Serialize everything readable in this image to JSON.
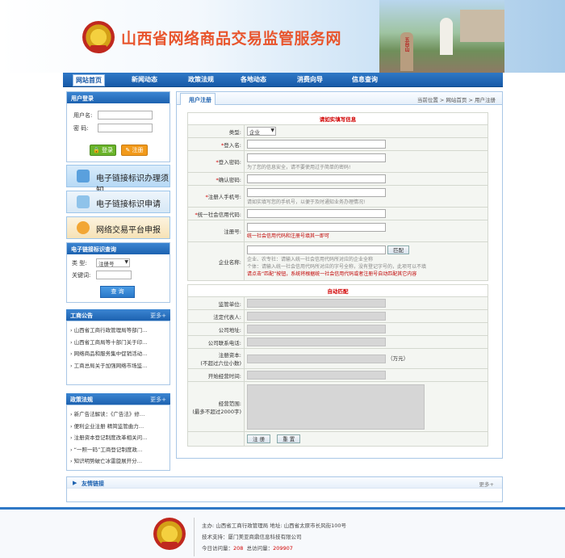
{
  "header": {
    "site_title": "山西省网络商品交易监管服务网",
    "mountain_text": "五台山"
  },
  "nav": {
    "items": [
      "网站首页",
      "新闻动态",
      "政策法规",
      "各地动态",
      "消费向导",
      "信息查询"
    ]
  },
  "login": {
    "title": "用户登录",
    "username_label": "用户名:",
    "password_label": "密  码:",
    "login_btn": "登录",
    "register_btn": "注册"
  },
  "side_buttons": [
    "电子链接标识办理须知",
    "电子链接标识申请",
    "网络交易平台申报"
  ],
  "query": {
    "title": "电子链接标识查询",
    "type_label": "类  型:",
    "type_value": "注册号",
    "keyword_label": "关键词:",
    "query_btn": "查 询"
  },
  "announcements": {
    "title": "工商公告",
    "more": "更多+",
    "items": [
      "山西省工商行政管理局等部门…",
      "山西省工商局等十部门关于印…",
      "网络商品和服务集中促销活动…",
      "工商总局关于加强网络市场监…"
    ]
  },
  "policies": {
    "title": "政策法规",
    "more": "更多+",
    "items": [
      "新广告法解读：《广告法》修…",
      "便利企业注册 精简监管曲力…",
      "注册资本登记制度改革相关问…",
      "“一照一码”工商登记制度政…",
      "知识明势破亡冰雷旋展开分…"
    ]
  },
  "main": {
    "tab": "用户注册",
    "crumb_prefix": "当前位置",
    "crumb_home": "网站首页",
    "crumb_current": "用户注册",
    "section1": "请如实填写信息",
    "type_label": "类型:",
    "type_value": "企业",
    "login_name": "登入名:",
    "password": "登入密码:",
    "password_hint": "为了您的信息安全，请不要使用过于简单的密码!",
    "confirm_password": "确认密码:",
    "phone": "注册人手机号:",
    "phone_hint": "请如实填写您的手机号，以便于及时通知业务办理情况!",
    "credit_code": "统一社会信用代码:",
    "reg_no": "注册号:",
    "reg_hint": "统一社会信用代码和注册号填其一即可",
    "company_name": "企业名称:",
    "match_btn": "匹配",
    "company_hint1": "企业、农专社：请输入统一社会信用代码所对应的企业全称",
    "company_hint2": "个体：请输入统一社会信用代码所对应的字号全称，没有登记字号的，此项可以不填",
    "company_hint3": "请点击“匹配”按钮，系统将根据统一社会信用代码或者注册号自动匹配其它内容",
    "section2": "自动匹配",
    "supervisor": "监管单位:",
    "legal_rep": "法定代表人:",
    "address": "公司地址:",
    "contact_phone": "公司联系电话:",
    "capital_label1": "注册资本:",
    "capital_label2": "(不超过六位小数)",
    "capital_unit": "（万元）",
    "start_time": "开始经营时间:",
    "scope_label1": "经营范围:",
    "scope_label2": "(最多不超过2000字)",
    "register_btn": "注 册",
    "reset_btn": "重 置"
  },
  "friend_links": {
    "title": "友情链接",
    "more": "更多+"
  },
  "footer": {
    "line1": "主办: 山西省工商行政管理局  地址: 山西省太原市长风街100号",
    "line2": "技术支持：厦门美亚商鼎信息科技有限公司",
    "visits_today_label": "今日访问量：",
    "visits_today": "208",
    "visits_total_label": "总访问量：",
    "visits_total": "209907"
  },
  "colors": {
    "nav_blue": "#1d62b0",
    "title_orange": "#e8552d",
    "required_red": "#d10000"
  }
}
